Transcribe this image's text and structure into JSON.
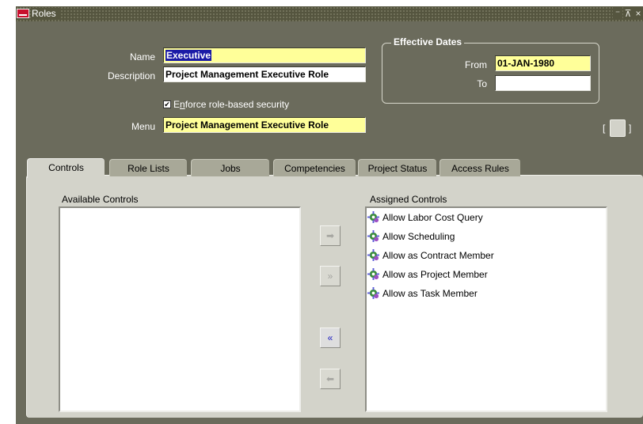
{
  "window": {
    "title": "Roles",
    "controls": {
      "minimize": "⁻",
      "maximize": "⊼",
      "close": "×"
    }
  },
  "form": {
    "name_label": "Name",
    "name_value": "Executive",
    "description_label": "Description",
    "description_value": "Project Management Executive Role",
    "enforce_checked": true,
    "enforce_label_first": "E",
    "enforce_label_underlined": "n",
    "enforce_label_rest": "force role-based security",
    "menu_label": "Menu",
    "menu_value": "Project Management Executive Role"
  },
  "effective_dates": {
    "title": "Effective Dates",
    "from_label": "From",
    "from_value": "01-JAN-1980",
    "to_label": "To",
    "to_value": ""
  },
  "side_button": {
    "left_bracket": "[",
    "right_bracket": "]"
  },
  "tabs": [
    {
      "label": "Controls",
      "active": true
    },
    {
      "label": "Role Lists",
      "active": false
    },
    {
      "label": "Jobs",
      "active": false
    },
    {
      "label": "Competencies",
      "active": false
    },
    {
      "label": "Project Status",
      "active": false
    },
    {
      "label": "Access Rules",
      "active": false
    }
  ],
  "controls_tab": {
    "available_title": "Available Controls",
    "available_items": [],
    "assigned_title": "Assigned Controls",
    "assigned_items": [
      "Allow Labor Cost Query",
      "Allow Scheduling",
      "Allow as Contract Member",
      "Allow as Project Member",
      "Allow as Task Member"
    ],
    "move_buttons": [
      {
        "name": "move-right-button",
        "glyph": "➡",
        "enabled": false
      },
      {
        "name": "move-all-right-button",
        "glyph": "»",
        "enabled": false
      },
      {
        "name": "move-all-left-button",
        "glyph": "«",
        "enabled": true
      },
      {
        "name": "move-left-button",
        "glyph": "⬅",
        "enabled": false
      }
    ]
  },
  "colors": {
    "window_bg": "#6b6b5c",
    "required_field": "#ffff99",
    "tab_panel": "#d3d3ca",
    "selection": "#1a1aa6"
  }
}
